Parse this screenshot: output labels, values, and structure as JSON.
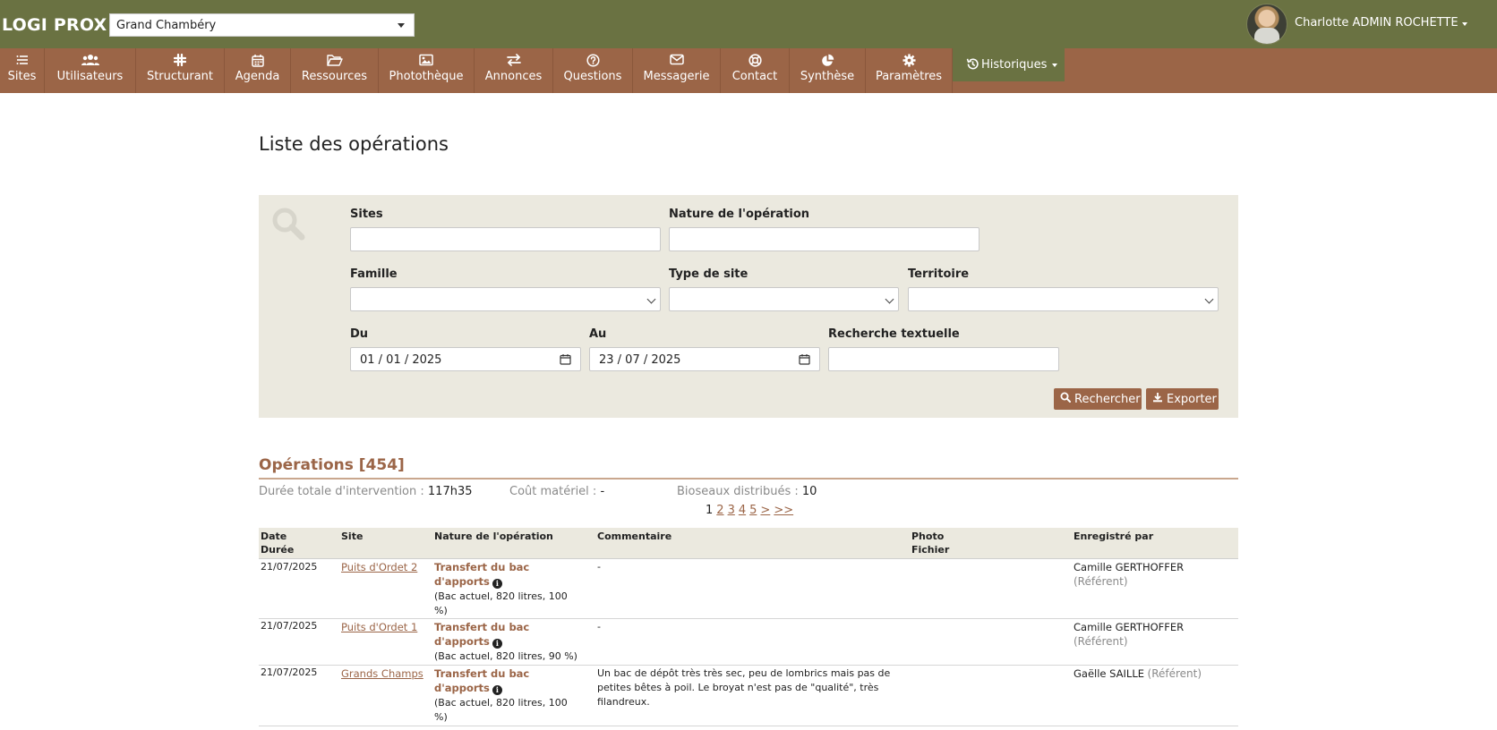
{
  "header": {
    "brand": "LOGI PROX -",
    "org_selected": "Grand Chambéry",
    "user_name": "Charlotte ADMIN ROCHETTE"
  },
  "nav": {
    "items": [
      {
        "label": "Sites",
        "icon": "list-icon"
      },
      {
        "label": "Utilisateurs",
        "icon": "users-icon"
      },
      {
        "label": "Structurant",
        "icon": "hashtag-icon"
      },
      {
        "label": "Agenda",
        "icon": "calendar-icon"
      },
      {
        "label": "Ressources",
        "icon": "folder-icon"
      },
      {
        "label": "Photothèque",
        "icon": "image-icon"
      },
      {
        "label": "Annonces",
        "icon": "exchange-icon"
      },
      {
        "label": "Questions",
        "icon": "question-icon"
      },
      {
        "label": "Messagerie",
        "icon": "envelope-icon"
      },
      {
        "label": "Contact",
        "icon": "lifebuoy-icon"
      },
      {
        "label": "Synthèse",
        "icon": "pie-chart-icon"
      },
      {
        "label": "Paramètres",
        "icon": "gear-icon"
      }
    ],
    "history": {
      "label": "Historiques",
      "icon": "history-icon"
    }
  },
  "page": {
    "title": "Liste des opérations"
  },
  "filters": {
    "sites": {
      "label": "Sites",
      "value": ""
    },
    "nature": {
      "label": "Nature de l'opération",
      "value": ""
    },
    "famille": {
      "label": "Famille",
      "value": ""
    },
    "type_site": {
      "label": "Type de site",
      "value": ""
    },
    "territoire": {
      "label": "Territoire",
      "value": ""
    },
    "du": {
      "label": "Du",
      "value": "01 / 01 / 2025"
    },
    "au": {
      "label": "Au",
      "value": "23 / 07 / 2025"
    },
    "recherche": {
      "label": "Recherche textuelle",
      "value": ""
    },
    "search_button": "Rechercher",
    "export_button": "Exporter"
  },
  "operations": {
    "title": "Opérations [454]",
    "stats": {
      "duree_label": "Durée totale d'intervention :",
      "duree_value": "117h35",
      "cout_label": "Coût matériel :",
      "cout_value": "-",
      "bioseaux_label": "Bioseaux distribués :",
      "bioseaux_value": "10"
    },
    "pagination": {
      "current": "1",
      "pages": [
        "2",
        "3",
        "4",
        "5",
        ">",
        ">>"
      ]
    },
    "columns": {
      "date": "Date",
      "duree": "Durée",
      "site": "Site",
      "nature": "Nature de l'opération",
      "commentaire": "Commentaire",
      "photo": "Photo",
      "fichier": "Fichier",
      "enregistre": "Enregistré par"
    },
    "rows": [
      {
        "date": "21/07/2025",
        "site": "Puits d'Ordet 2",
        "nature_1": "Transfert du bac",
        "nature_2": "d'apports",
        "detail_1": "(Bac actuel, 820 litres, 100",
        "detail_2": "%)",
        "comment_1": "-",
        "comment_2": "",
        "comment_3": "",
        "user": "Camille GERTHOFFER",
        "role": "(Référent)"
      },
      {
        "date": "21/07/2025",
        "site": "Puits d'Ordet 1",
        "nature_1": "Transfert du bac",
        "nature_2": "d'apports",
        "detail_1": "(Bac actuel, 820 litres, 90 %)",
        "detail_2": "",
        "comment_1": "-",
        "comment_2": "",
        "comment_3": "",
        "user": "Camille GERTHOFFER",
        "role": "(Référent)"
      },
      {
        "date": "21/07/2025",
        "site": "Grands Champs",
        "nature_1": "Transfert du bac",
        "nature_2": "d'apports",
        "detail_1": "(Bac actuel, 820 litres, 100",
        "detail_2": "%)",
        "comment_1": "Un bac de dépôt très très sec, peu de lombrics mais pas de",
        "comment_2": "petites bêtes à poil. Le broyat n'est pas de \"qualité\", très",
        "comment_3": "filandreux.",
        "user": "Gaëlle SAILLE",
        "role": "(Référent)"
      }
    ]
  },
  "colors": {
    "topbar": "#6a7242",
    "nav": "#9b6547",
    "accent": "#9b6547",
    "panel": "#ebe9df"
  }
}
